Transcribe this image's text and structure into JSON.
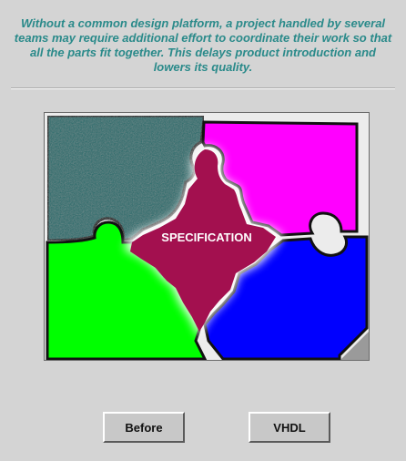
{
  "intro": {
    "text": "Without a common design platform, a project handled by several teams may require additional effort to coordinate their work so that all the parts fit together. This delays product introduction and lowers its quality."
  },
  "puzzle": {
    "center_label": "SPECIFICATION",
    "colors": {
      "teal": "#1f6b6b",
      "magenta": "#ff00ff",
      "green": "#00ff00",
      "blue": "#0000ff",
      "center": "#a3104f",
      "glow": "#ffffff",
      "outline": "#111111"
    }
  },
  "buttons": {
    "before": "Before",
    "vhdl": "VHDL"
  }
}
